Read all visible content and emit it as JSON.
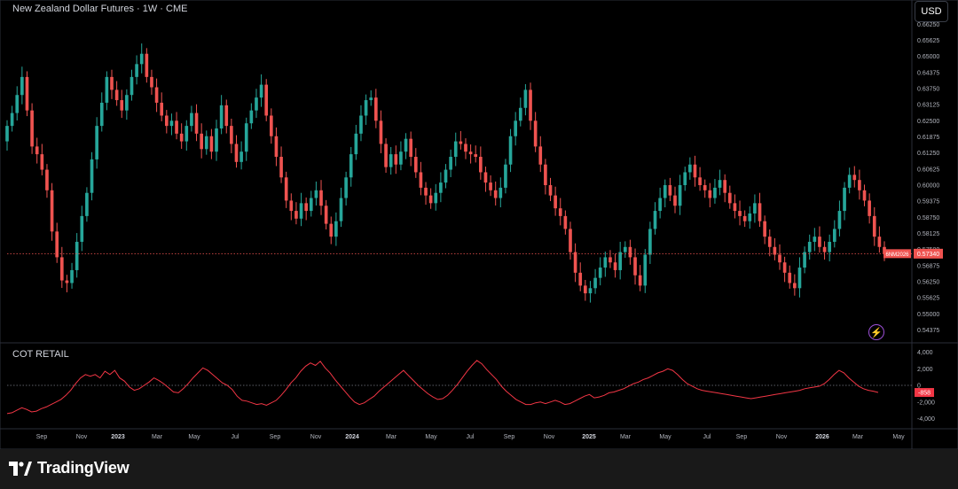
{
  "header": {
    "title": "New Zealand Dollar Futures · 1W · CME",
    "currency_button": "USD"
  },
  "indicator": {
    "label": "COT RETAIL"
  },
  "branding": {
    "name": "TradingView"
  },
  "colors": {
    "up": "#26a69a",
    "down": "#ef5350",
    "cot_line": "#f23645",
    "background": "#000000"
  },
  "chart_data": [
    {
      "type": "candlestick",
      "title": "New Zealand Dollar Futures · 1W · CME",
      "ylim": [
        0.5405,
        0.665
      ],
      "y_ticks": [
        "0.66250",
        "0.65625",
        "0.65000",
        "0.64375",
        "0.63750",
        "0.63125",
        "0.62500",
        "0.61875",
        "0.61250",
        "0.60625",
        "0.60000",
        "0.59375",
        "0.58750",
        "0.58125",
        "0.57500",
        "0.56875",
        "0.56250",
        "0.55625",
        "0.55000",
        "0.54375"
      ],
      "x_ticks": [
        "Sep",
        "Nov",
        "2023",
        "Mar",
        "May",
        "Jul",
        "Sep",
        "Nov",
        "2024",
        "Mar",
        "May",
        "Jul",
        "Sep",
        "Nov",
        "2025",
        "Mar",
        "May",
        "Jul",
        "Sep",
        "Nov",
        "2026",
        "Mar",
        "May"
      ],
      "last_price": 0.5734,
      "last_price_label": "0.57340",
      "symbol_label": "6NM2026",
      "closes": [
        0.623,
        0.628,
        0.635,
        0.642,
        0.629,
        0.615,
        0.612,
        0.606,
        0.598,
        0.582,
        0.572,
        0.563,
        0.562,
        0.567,
        0.578,
        0.588,
        0.597,
        0.61,
        0.623,
        0.632,
        0.642,
        0.637,
        0.633,
        0.629,
        0.635,
        0.642,
        0.647,
        0.651,
        0.642,
        0.638,
        0.632,
        0.627,
        0.623,
        0.625,
        0.62,
        0.617,
        0.623,
        0.628,
        0.62,
        0.614,
        0.619,
        0.613,
        0.622,
        0.631,
        0.623,
        0.616,
        0.609,
        0.613,
        0.624,
        0.629,
        0.634,
        0.639,
        0.627,
        0.619,
        0.611,
        0.603,
        0.594,
        0.59,
        0.587,
        0.593,
        0.59,
        0.595,
        0.598,
        0.592,
        0.585,
        0.58,
        0.586,
        0.595,
        0.603,
        0.612,
        0.62,
        0.627,
        0.633,
        0.634,
        0.625,
        0.616,
        0.607,
        0.612,
        0.608,
        0.613,
        0.618,
        0.611,
        0.605,
        0.599,
        0.596,
        0.593,
        0.597,
        0.601,
        0.606,
        0.611,
        0.617,
        0.616,
        0.613,
        0.612,
        0.611,
        0.605,
        0.601,
        0.598,
        0.595,
        0.599,
        0.608,
        0.619,
        0.625,
        0.63,
        0.637,
        0.625,
        0.615,
        0.608,
        0.6,
        0.596,
        0.591,
        0.588,
        0.583,
        0.574,
        0.566,
        0.561,
        0.558,
        0.56,
        0.564,
        0.568,
        0.572,
        0.57,
        0.567,
        0.574,
        0.576,
        0.572,
        0.565,
        0.561,
        0.573,
        0.583,
        0.59,
        0.595,
        0.6,
        0.596,
        0.592,
        0.6,
        0.605,
        0.608,
        0.603,
        0.6,
        0.598,
        0.595,
        0.599,
        0.602,
        0.597,
        0.593,
        0.59,
        0.588,
        0.586,
        0.589,
        0.593,
        0.586,
        0.58,
        0.576,
        0.573,
        0.57,
        0.566,
        0.562,
        0.56,
        0.568,
        0.574,
        0.578,
        0.58,
        0.576,
        0.574,
        0.578,
        0.583,
        0.59,
        0.599,
        0.604,
        0.602,
        0.598,
        0.594,
        0.588,
        0.58,
        0.576,
        0.5734
      ],
      "open_first": 0.617
    },
    {
      "type": "line",
      "title": "COT RETAIL",
      "ylim": [
        -4800,
        4800
      ],
      "y_ticks": [
        "4,000",
        "2,000",
        "0",
        "-2,000",
        "-4,000"
      ],
      "last_value": -858,
      "last_value_label": "-858",
      "values": [
        -3400,
        -3300,
        -3000,
        -2700,
        -2900,
        -3200,
        -3100,
        -2800,
        -2600,
        -2300,
        -2000,
        -1700,
        -1200,
        -600,
        200,
        900,
        1300,
        1100,
        1300,
        900,
        1700,
        1300,
        1800,
        900,
        500,
        -200,
        -600,
        -400,
        0,
        400,
        900,
        600,
        200,
        -300,
        -800,
        -900,
        -400,
        200,
        900,
        1500,
        2100,
        1800,
        1300,
        800,
        300,
        0,
        -500,
        -1300,
        -1800,
        -1900,
        -2100,
        -2300,
        -2200,
        -2400,
        -2100,
        -1800,
        -1200,
        -500,
        300,
        900,
        1700,
        2300,
        2700,
        2400,
        2900,
        2100,
        1500,
        700,
        0,
        -700,
        -1400,
        -2000,
        -2300,
        -2100,
        -1700,
        -1300,
        -700,
        -200,
        300,
        800,
        1300,
        1800,
        1200,
        600,
        0,
        -500,
        -1000,
        -1400,
        -1700,
        -1600,
        -1200,
        -600,
        100,
        900,
        1700,
        2400,
        3000,
        2600,
        1900,
        1300,
        700,
        -100,
        -700,
        -1200,
        -1700,
        -2000,
        -2300,
        -2300,
        -2100,
        -2000,
        -2200,
        -2000,
        -1800,
        -2000,
        -2300,
        -2200,
        -1900,
        -1600,
        -1300,
        -1100,
        -1500,
        -1400,
        -1200,
        -900,
        -800,
        -600,
        -400,
        -100,
        200,
        400,
        700,
        900,
        1200,
        1500,
        1700,
        2000,
        1800,
        1300,
        700,
        200,
        -100,
        -400,
        -600,
        -700,
        -800,
        -900,
        -1000,
        -1100,
        -1200,
        -1300,
        -1400,
        -1500,
        -1600,
        -1500,
        -1400,
        -1300,
        -1200,
        -1100,
        -1000,
        -900,
        -800,
        -700,
        -600,
        -400,
        -300,
        -200,
        -100,
        200,
        700,
        1300,
        1800,
        1500,
        900,
        400,
        -100,
        -400,
        -600,
        -700,
        -858
      ]
    }
  ]
}
